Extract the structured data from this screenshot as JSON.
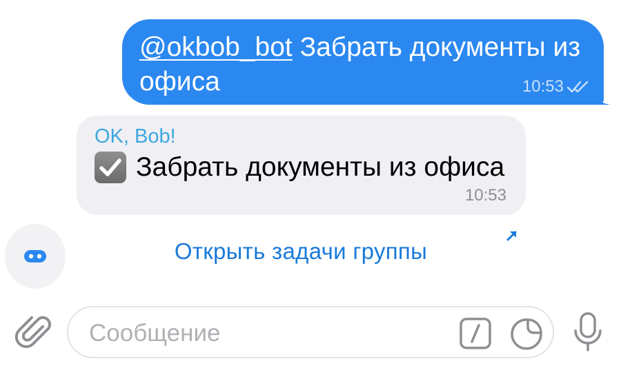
{
  "outgoing": {
    "mention": "@okbob_bot",
    "text": "Забрать документы из офиса",
    "time": "10:53",
    "status": "read-double-check-icon"
  },
  "incoming": {
    "sender": "OK, Bob!",
    "task": "Забрать документы из офиса",
    "task_checked": true,
    "time": "10:53"
  },
  "button": {
    "label": "Открыть задачи группы"
  },
  "composer": {
    "placeholder": "Сообщение"
  },
  "colors": {
    "outgoing_bubble": "#2b88f0",
    "incoming_bubble": "#efeff4",
    "sender_name": "#3ea7e0",
    "link": "#1a7ad9"
  },
  "icons": [
    "bot-icon",
    "attach-icon",
    "slash-commands-icon",
    "sticker-icon",
    "microphone-icon",
    "arrow-up-right-icon",
    "checkbox-checked-icon"
  ]
}
